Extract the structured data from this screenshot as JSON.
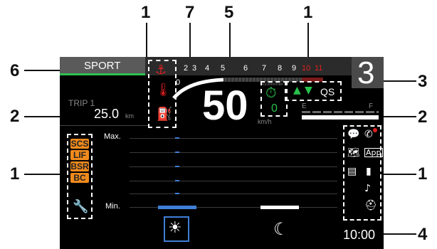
{
  "callouts": {
    "c1_top_left": "1",
    "c7": "7",
    "c5": "5",
    "c1_top_right": "1",
    "c6": "6",
    "c3": "3",
    "c2_left": "2",
    "c2_right": "2",
    "c1_left": "1",
    "c1_right": "1",
    "c4": "4"
  },
  "mode": {
    "label": "SPORT"
  },
  "trip": {
    "label": "TRIP 1",
    "value": "25.0",
    "unit": "km"
  },
  "tachometer": {
    "ticks": [
      "2",
      "3",
      "4",
      "5",
      "6",
      "7",
      "8",
      "9",
      "10",
      "11"
    ],
    "zero": "0",
    "unit_label": "x1000r/min"
  },
  "speed": {
    "value": "50",
    "unit": "km/h"
  },
  "gear": {
    "value": "3"
  },
  "quickshift": {
    "label": "QS",
    "zero": "0"
  },
  "fuel": {
    "full_label": "F",
    "empty_label": "E"
  },
  "indicators_left": [
    "SCS",
    "LIF",
    "BSR",
    "BC"
  ],
  "brightness": {
    "max_label": "Max.",
    "min_label": "Min.",
    "level_day": 0.0,
    "level_night": 0.0
  },
  "clock": {
    "time": "10:00"
  },
  "icons": {
    "oil": "oil-pressure-warning-icon",
    "temp": "coolant-temperature-warning-icon",
    "fuel_warn": "low-fuel-warning-icon",
    "shift": "shift-indicator-icon",
    "wrench": "service-wrench-icon",
    "sun": "day-mode-sun-icon",
    "moon": "night-mode-moon-icon",
    "message": "message-icon",
    "phone": "phone-icon",
    "map": "navigation-map-icon",
    "app": "app-icon",
    "signal": "signal-strength-icon",
    "battery": "phone-battery-icon",
    "headset": "headset-icon",
    "helmet": "helmet-connection-icon"
  },
  "colors": {
    "accent_orange": "#f08a1c",
    "quickshift_green": "#27c24c",
    "brightness_blue": "#3f7fd6",
    "redline": "#e02020"
  }
}
